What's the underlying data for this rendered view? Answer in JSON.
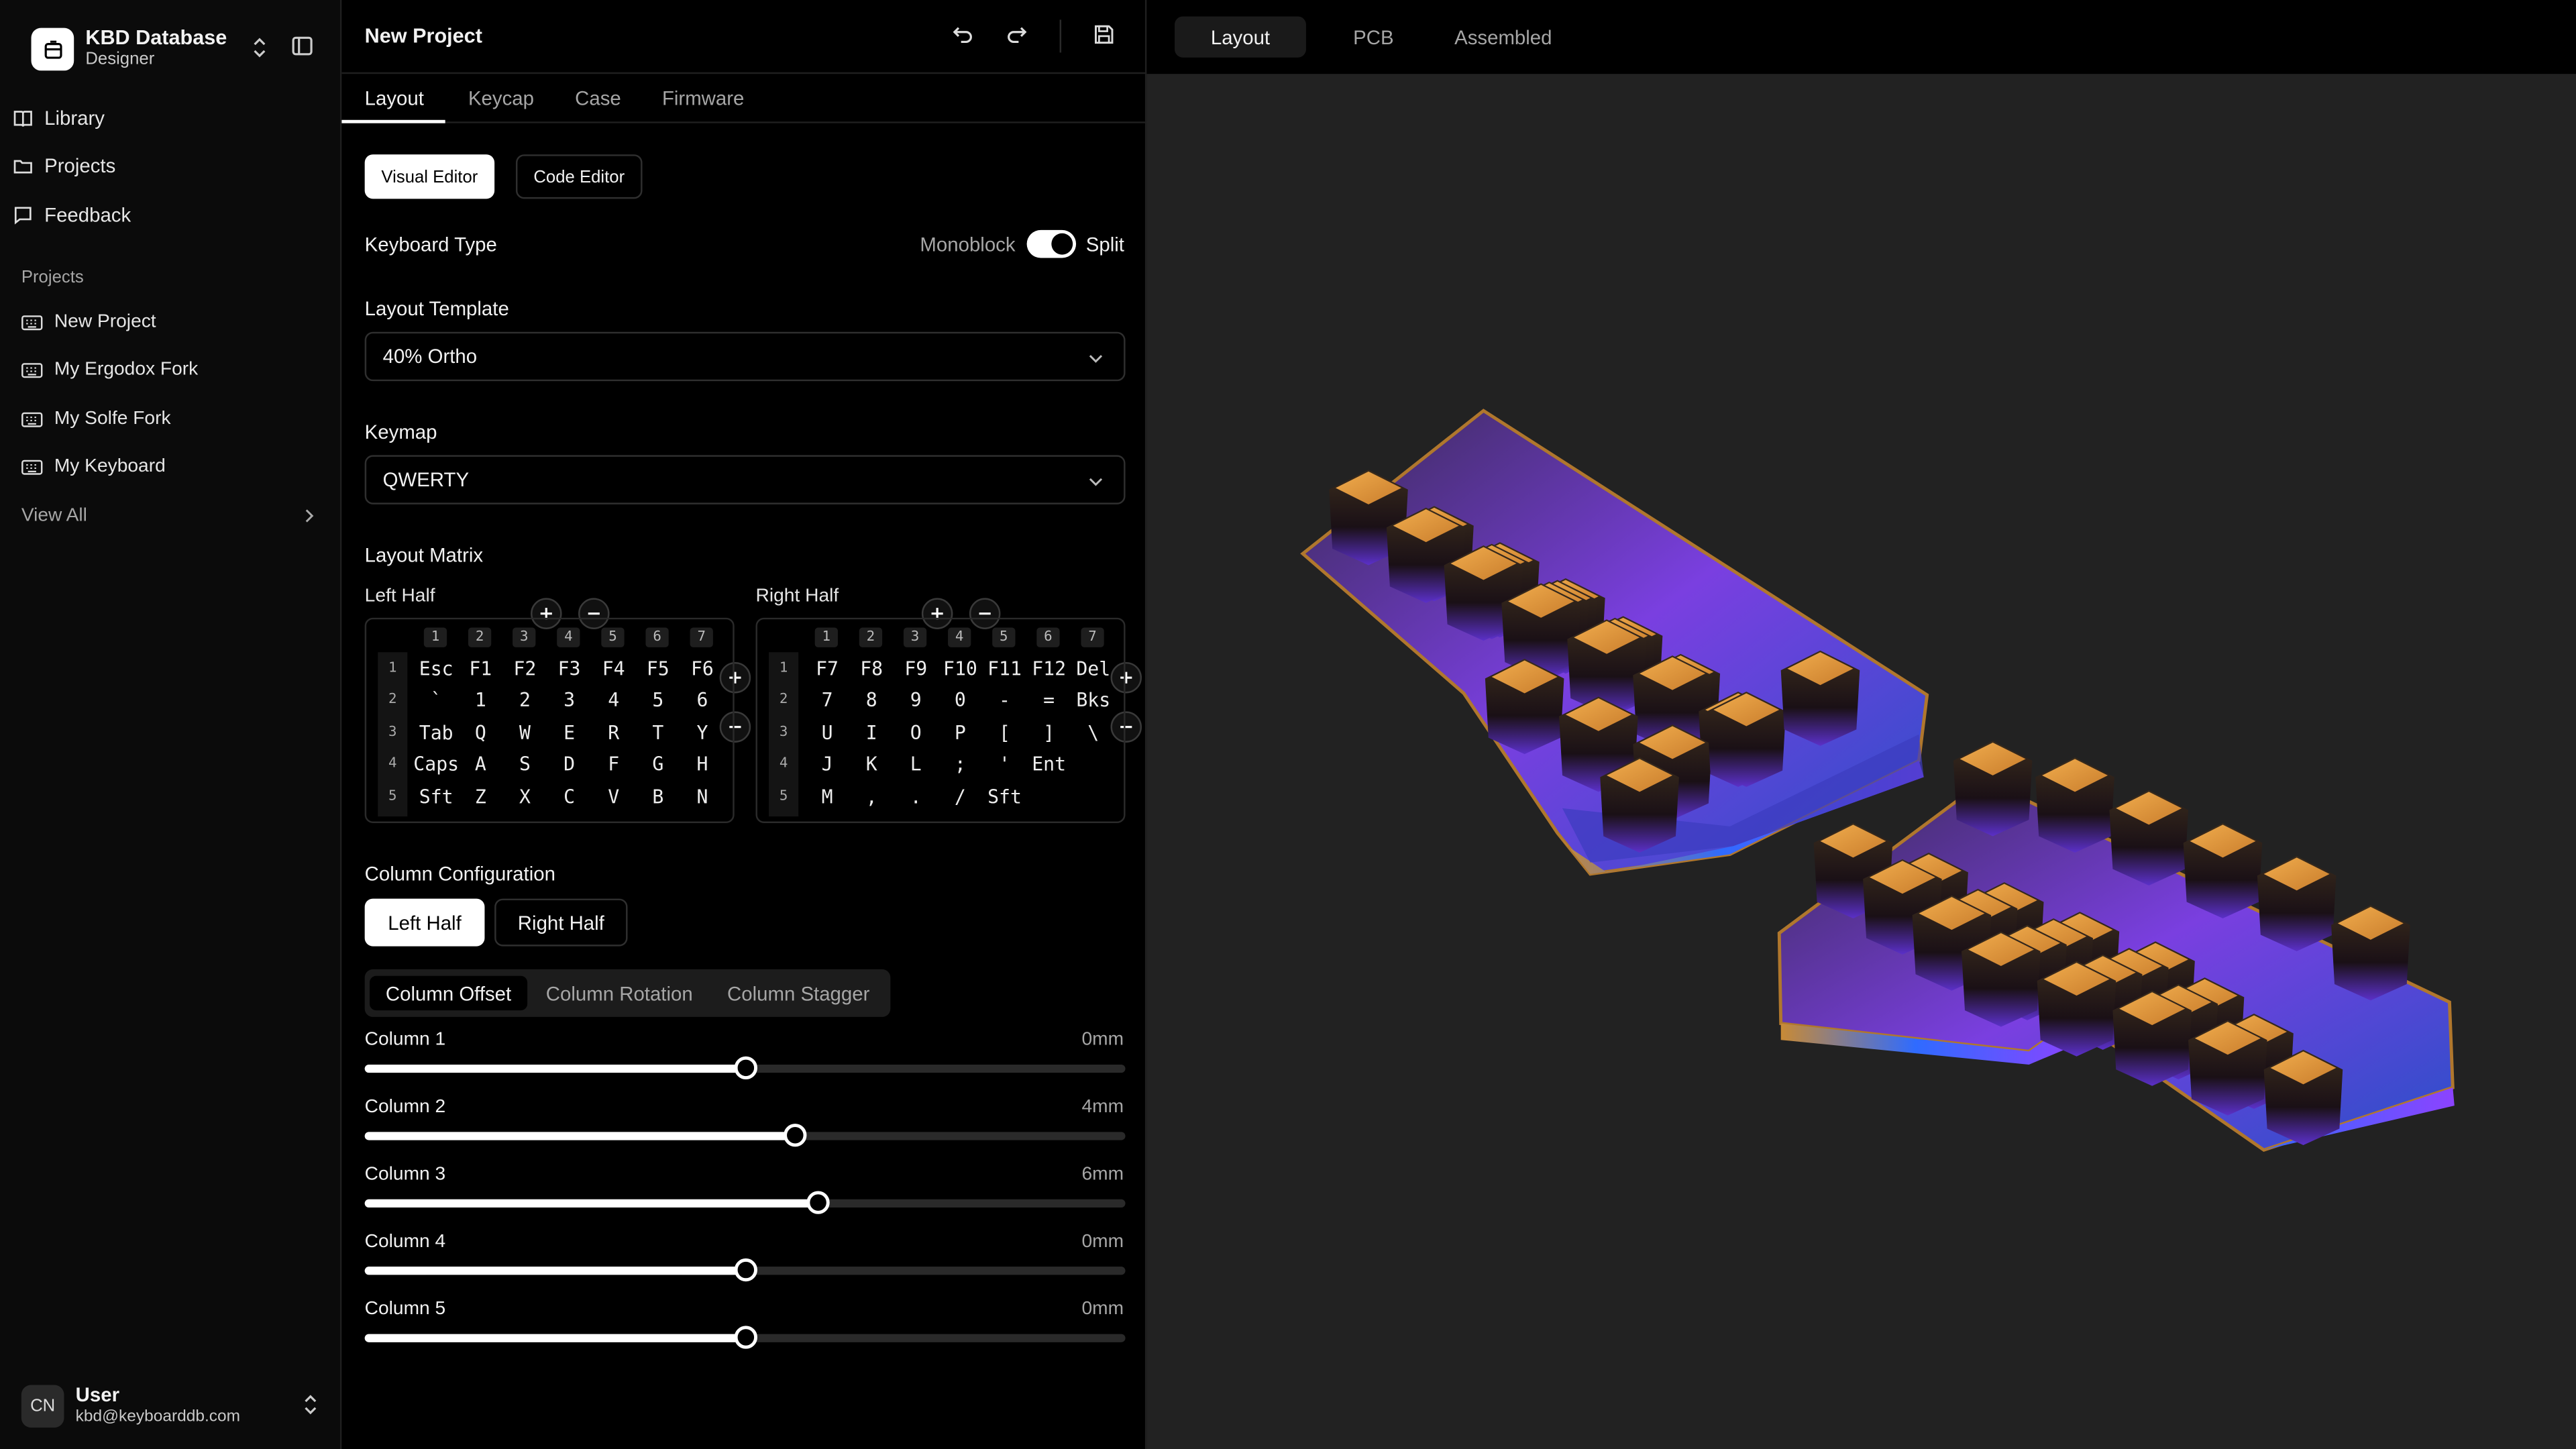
{
  "brand": {
    "title": "KBD Database",
    "subtitle": "Designer"
  },
  "nav": [
    {
      "label": "Library",
      "icon": "book-icon"
    },
    {
      "label": "Projects",
      "icon": "folder-icon"
    },
    {
      "label": "Feedback",
      "icon": "message-icon"
    }
  ],
  "projects": {
    "section_label": "Projects",
    "items": [
      "New Project",
      "My Ergodox Fork",
      "My Solfe Fork",
      "My Keyboard"
    ],
    "view_all": "View All"
  },
  "user": {
    "initials": "CN",
    "name": "User",
    "email": "kbd@keyboarddb.com"
  },
  "editor": {
    "project_title": "New Project",
    "tabs": [
      "Layout",
      "Keycap",
      "Case",
      "Firmware"
    ],
    "active_tab": "Layout",
    "modes": {
      "visual": "Visual Editor",
      "code": "Code Editor"
    },
    "keyboard_type": {
      "label": "Keyboard Type",
      "left": "Monoblock",
      "right": "Split",
      "value": "Split"
    },
    "layout_template": {
      "label": "Layout Template",
      "value": "40% Ortho"
    },
    "keymap": {
      "label": "Keymap",
      "value": "QWERTY"
    },
    "matrix": {
      "label": "Layout Matrix",
      "left_label": "Left Half",
      "right_label": "Right Half",
      "col_heads": [
        "1",
        "2",
        "3",
        "4",
        "5",
        "6",
        "7"
      ],
      "row_heads": [
        "1",
        "2",
        "3",
        "4",
        "5"
      ],
      "left": [
        [
          "Esc",
          "F1",
          "F2",
          "F3",
          "F4",
          "F5",
          "F6"
        ],
        [
          "`",
          "1",
          "2",
          "3",
          "4",
          "5",
          "6"
        ],
        [
          "Tab",
          "Q",
          "W",
          "E",
          "R",
          "T",
          "Y"
        ],
        [
          "Caps",
          "A",
          "S",
          "D",
          "F",
          "G",
          "H"
        ],
        [
          "Sft",
          "Z",
          "X",
          "C",
          "V",
          "B",
          "N"
        ]
      ],
      "right": [
        [
          "F7",
          "F8",
          "F9",
          "F10",
          "F11",
          "F12",
          "Del"
        ],
        [
          "7",
          "8",
          "9",
          "0",
          "-",
          "=",
          "Bks"
        ],
        [
          "U",
          "I",
          "O",
          "P",
          "[",
          "]",
          "\\"
        ],
        [
          "J",
          "K",
          "L",
          ";",
          "'",
          "Ent",
          ""
        ],
        [
          "M",
          ",",
          ".",
          "/",
          "Sft",
          "",
          ""
        ]
      ]
    },
    "column_config": {
      "label": "Column Configuration",
      "halves": [
        "Left Half",
        "Right Half"
      ],
      "subtabs": [
        "Column Offset",
        "Column Rotation",
        "Column Stagger"
      ],
      "columns": [
        {
          "label": "Column 1",
          "value": "0mm",
          "level": 0.5
        },
        {
          "label": "Column 2",
          "value": "4mm",
          "level": 0.565
        },
        {
          "label": "Column 3",
          "value": "6mm",
          "level": 0.597
        },
        {
          "label": "Column 4",
          "value": "0mm",
          "level": 0.5
        },
        {
          "label": "Column 5",
          "value": "0mm",
          "level": 0.5
        }
      ]
    }
  },
  "preview": {
    "tabs": [
      "Layout",
      "PCB",
      "Assembled"
    ],
    "active": "Layout"
  },
  "colors": {
    "keycap_top": "#e69a3f",
    "case_purple": "#8a45ff",
    "case_blue": "#2c6cff",
    "bg_preview": "#222222"
  }
}
